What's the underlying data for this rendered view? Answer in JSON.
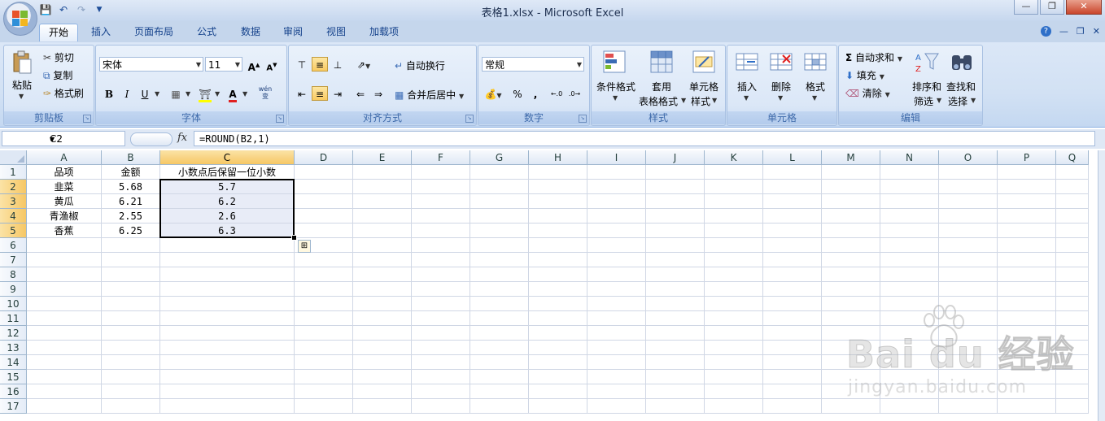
{
  "window": {
    "title": "表格1.xlsx - Microsoft Excel",
    "controls": [
      "minimize",
      "restore",
      "close"
    ]
  },
  "quick_access": [
    "save-icon",
    "undo-icon",
    "redo-icon",
    "customize-icon"
  ],
  "tabs": [
    {
      "label": "开始",
      "active": true
    },
    {
      "label": "插入"
    },
    {
      "label": "页面布局"
    },
    {
      "label": "公式"
    },
    {
      "label": "数据"
    },
    {
      "label": "审阅"
    },
    {
      "label": "视图"
    },
    {
      "label": "加载项"
    }
  ],
  "ribbon": {
    "clipboard": {
      "label": "剪贴板",
      "paste": "粘贴",
      "cut": "剪切",
      "copy": "复制",
      "format_painter": "格式刷"
    },
    "font": {
      "label": "字体",
      "font_name": "宋体",
      "font_size": "11",
      "bold": "B",
      "italic": "I",
      "underline": "U",
      "phonetic": "wén"
    },
    "alignment": {
      "label": "对齐方式",
      "wrap": "自动换行",
      "merge": "合并后居中"
    },
    "number": {
      "label": "数字",
      "format": "常规",
      "percent": "%",
      "comma": ","
    },
    "styles": {
      "label": "样式",
      "conditional": "条件格式",
      "table_line1": "套用",
      "table_line2": "表格格式",
      "cell_styles_line1": "单元格",
      "cell_styles_line2": "样式"
    },
    "cells": {
      "label": "单元格",
      "insert": "插入",
      "delete": "删除",
      "format": "格式"
    },
    "editing": {
      "label": "编辑",
      "autosum": "自动求和",
      "fill": "填充",
      "clear": "清除",
      "sort_line1": "排序和",
      "sort_line2": "筛选",
      "find_line1": "查找和",
      "find_line2": "选择"
    }
  },
  "formula_bar": {
    "name_box": "C2",
    "fx": "fx",
    "formula": "=ROUND(B2,1)"
  },
  "sheet": {
    "columns": [
      "A",
      "B",
      "C",
      "D",
      "E",
      "F",
      "G",
      "H",
      "I",
      "J",
      "K",
      "L",
      "M",
      "N",
      "O",
      "P",
      "Q"
    ],
    "selected_column": "C",
    "rows": [
      "1",
      "2",
      "3",
      "4",
      "5",
      "6",
      "7",
      "8",
      "9",
      "10",
      "11",
      "12",
      "13",
      "14",
      "15",
      "16",
      "17"
    ],
    "selected_rows": [
      "2",
      "3",
      "4",
      "5"
    ],
    "data": [
      [
        "品项",
        "金额",
        "小数点后保留一位小数"
      ],
      [
        "韭菜",
        "5.68",
        "5.7"
      ],
      [
        "黄瓜",
        "6.21",
        "6.2"
      ],
      [
        "青渔椒",
        "2.55",
        "2.6"
      ],
      [
        "香蕉",
        "6.25",
        "6.3"
      ]
    ]
  },
  "watermark": {
    "brand": "Bai du 经验",
    "url": "jingyan.baidu.com"
  },
  "colors": {
    "accent": "#15428b",
    "selection_header": "#f6c765",
    "selection_fill": "#e8ecf7",
    "ribbon_bg": "#dbe7f7"
  }
}
